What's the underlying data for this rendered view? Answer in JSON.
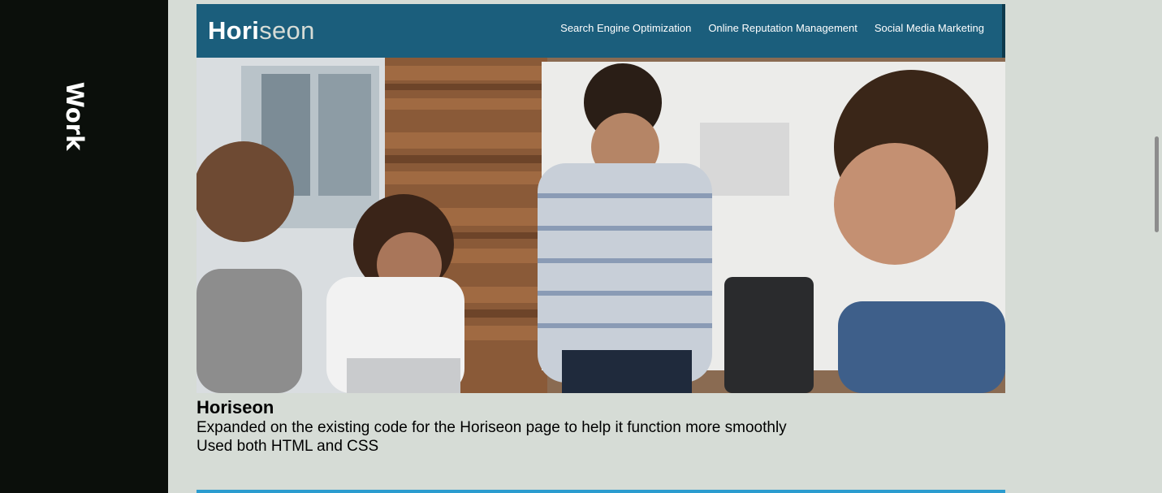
{
  "sidebar": {
    "section_title": "Work"
  },
  "project": {
    "logo_main": "Hori",
    "logo_accent": "seon",
    "nav": [
      "Search Engine Optimization",
      "Online Reputation Management",
      "Social Media Marketing"
    ],
    "title": "Horiseon",
    "description": "Expanded on the existing code for the Horiseon page to help it function more smoothly",
    "tech": "Used both HTML and CSS"
  },
  "colors": {
    "sidebar_bg": "#0b0f0b",
    "page_bg": "#d6dcd6",
    "header_bg": "#1b5e7c",
    "accent_bar": "#2b9ccf"
  }
}
